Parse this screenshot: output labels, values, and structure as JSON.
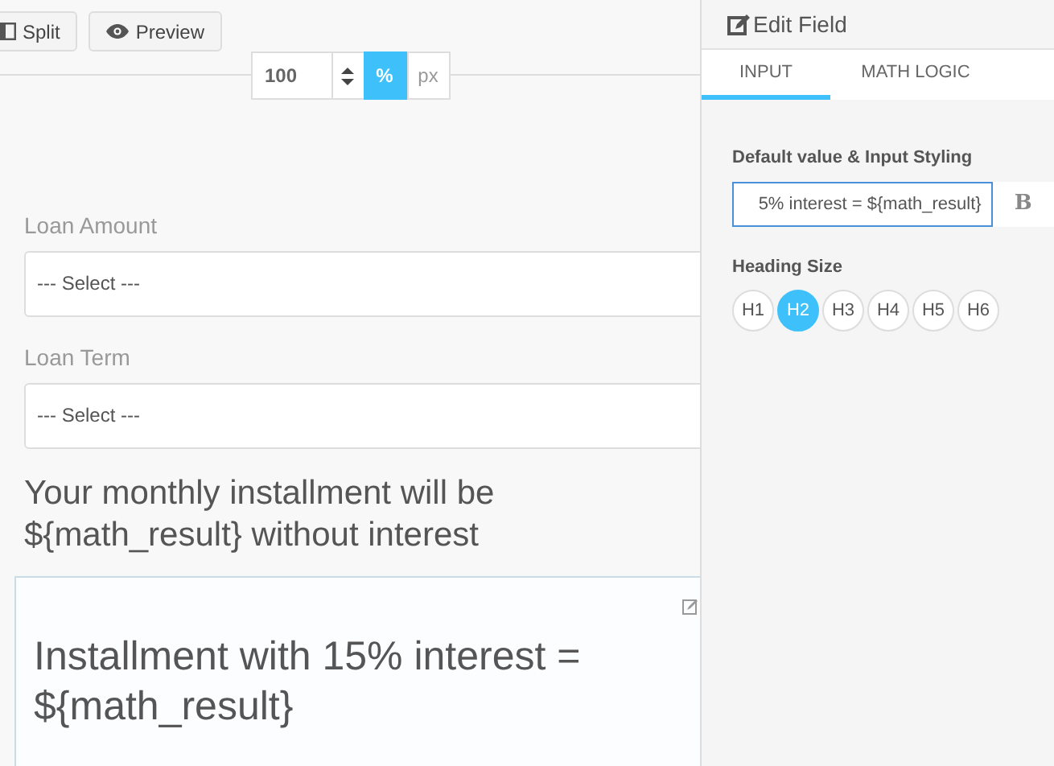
{
  "toolbar": {
    "buttons": [
      {
        "label": "Split",
        "kind": "split"
      },
      {
        "label": "Preview",
        "kind": "preview"
      }
    ]
  },
  "width_control": {
    "value": "100",
    "units": [
      {
        "label": "%",
        "selected": true
      },
      {
        "label": "px",
        "selected": false
      }
    ]
  },
  "form": {
    "fields": [
      {
        "kind": "select",
        "label": "Loan Amount",
        "placeholder": "--- Select ---"
      },
      {
        "kind": "select",
        "label": "Loan Term",
        "placeholder": "--- Select ---"
      },
      {
        "kind": "heading",
        "text": "Your monthly installment will be ${math_result} without interest",
        "editing": false
      },
      {
        "kind": "heading",
        "text": "Installment with 15% interest = ${math_result}",
        "editing": true
      }
    ]
  },
  "panel": {
    "title": "Edit Field",
    "tabs": [
      {
        "label": "INPUT",
        "selected": true
      },
      {
        "label": "MATH LOGIC",
        "selected": false
      }
    ],
    "default_value_label": "Default value & Input Styling",
    "default_value": "5% interest = ${math_result}",
    "bold_button": "B",
    "heading_size_label": "Heading Size",
    "heading_sizes": [
      {
        "label": "H1",
        "selected": false
      },
      {
        "label": "H2",
        "selected": true
      },
      {
        "label": "H3",
        "selected": false
      },
      {
        "label": "H4",
        "selected": false
      },
      {
        "label": "H5",
        "selected": false
      },
      {
        "label": "H6",
        "selected": false
      }
    ]
  }
}
